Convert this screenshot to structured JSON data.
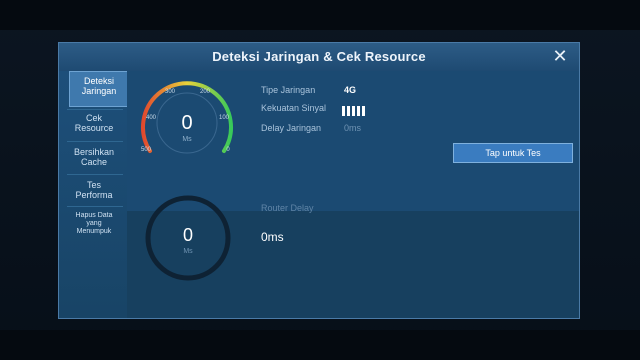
{
  "dialog": {
    "title": "Deteksi Jaringan & Cek Resource"
  },
  "sidebar": {
    "items": [
      {
        "line1": "Deteksi",
        "line2": "Jaringan"
      },
      {
        "line1": "Cek",
        "line2": "Resource"
      },
      {
        "line1": "Bersihkan",
        "line2": "Cache"
      },
      {
        "line1": "Tes",
        "line2": "Performa"
      },
      {
        "line1": "Hapus Data",
        "line2": "yang",
        "line3": "Menumpuk"
      }
    ]
  },
  "gauge": {
    "value": "0",
    "unit": "Ms",
    "ticks": [
      "500",
      "400",
      "300",
      "200",
      "100",
      "0"
    ]
  },
  "network": {
    "type_label": "Tipe Jaringan",
    "type_value": "4G",
    "signal_label": "Kekuatan Sinyal",
    "signal_bars": 5,
    "delay_label": "Delay Jaringan",
    "delay_value": "0ms"
  },
  "test_button": {
    "label": "Tap untuk Tes"
  },
  "router": {
    "label": "Router Delay",
    "value": "0ms",
    "ring_value": "0",
    "ring_unit": "Ms"
  },
  "colors": {
    "accent": "#3a7cc0",
    "panel": "#1b4a72",
    "gauge_low": "#38c95a",
    "gauge_mid": "#e8d23a",
    "gauge_high": "#e0492e"
  }
}
